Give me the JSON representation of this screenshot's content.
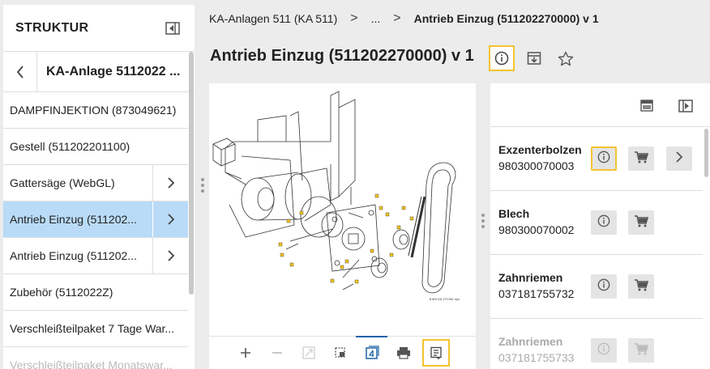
{
  "left_panel": {
    "title": "STRUKTUR",
    "back_label": "KA-Anlage 5112022 ...",
    "items": [
      {
        "label": "DAMPFINJEKTION (873049621)",
        "has_children": false,
        "selected": false,
        "faded": false
      },
      {
        "label": "Gestell (511202201100)",
        "has_children": false,
        "selected": false,
        "faded": false
      },
      {
        "label": "Gattersäge (WebGL)",
        "has_children": true,
        "selected": false,
        "faded": false
      },
      {
        "label": "Antrieb Einzug (511202...",
        "has_children": true,
        "selected": true,
        "faded": false
      },
      {
        "label": "Antrieb Einzug (511202...",
        "has_children": true,
        "selected": false,
        "faded": false
      },
      {
        "label": "Zubehör (5112022Z)",
        "has_children": false,
        "selected": false,
        "faded": false
      },
      {
        "label": "Verschleißteilpaket 7 Tage War...",
        "has_children": false,
        "selected": false,
        "faded": false
      },
      {
        "label": "Verschleißteilpaket Monatswar...",
        "has_children": false,
        "selected": false,
        "faded": true
      }
    ]
  },
  "breadcrumb": {
    "first": "KA-Anlagen 511 (KA 511)",
    "separator": ">",
    "middle": "...",
    "current": "Antrieb Einzug (511202270000) v 1"
  },
  "page": {
    "title": "Antrieb Einzug (511202270000) v 1"
  },
  "drawing": {
    "caption": "B 800 511 270 000 .eps"
  },
  "parts": [
    {
      "name": "Exzenterbolzen",
      "number": "980300070003",
      "has_detail": true,
      "info_highlighted": true,
      "faded": false
    },
    {
      "name": "Blech",
      "number": "980300070002",
      "has_detail": false,
      "info_highlighted": false,
      "faded": false
    },
    {
      "name": "Zahnriemen",
      "number": "037181755732",
      "has_detail": false,
      "info_highlighted": false,
      "faded": false
    },
    {
      "name": "Zahnriemen",
      "number": "037181755733",
      "has_detail": false,
      "info_highlighted": false,
      "faded": true
    }
  ],
  "colors": {
    "selected_row": "#b9dbf7",
    "highlight_outline": "#f4c430",
    "active_tool": "#1e63a8",
    "callout_marker": "#f5c518"
  }
}
